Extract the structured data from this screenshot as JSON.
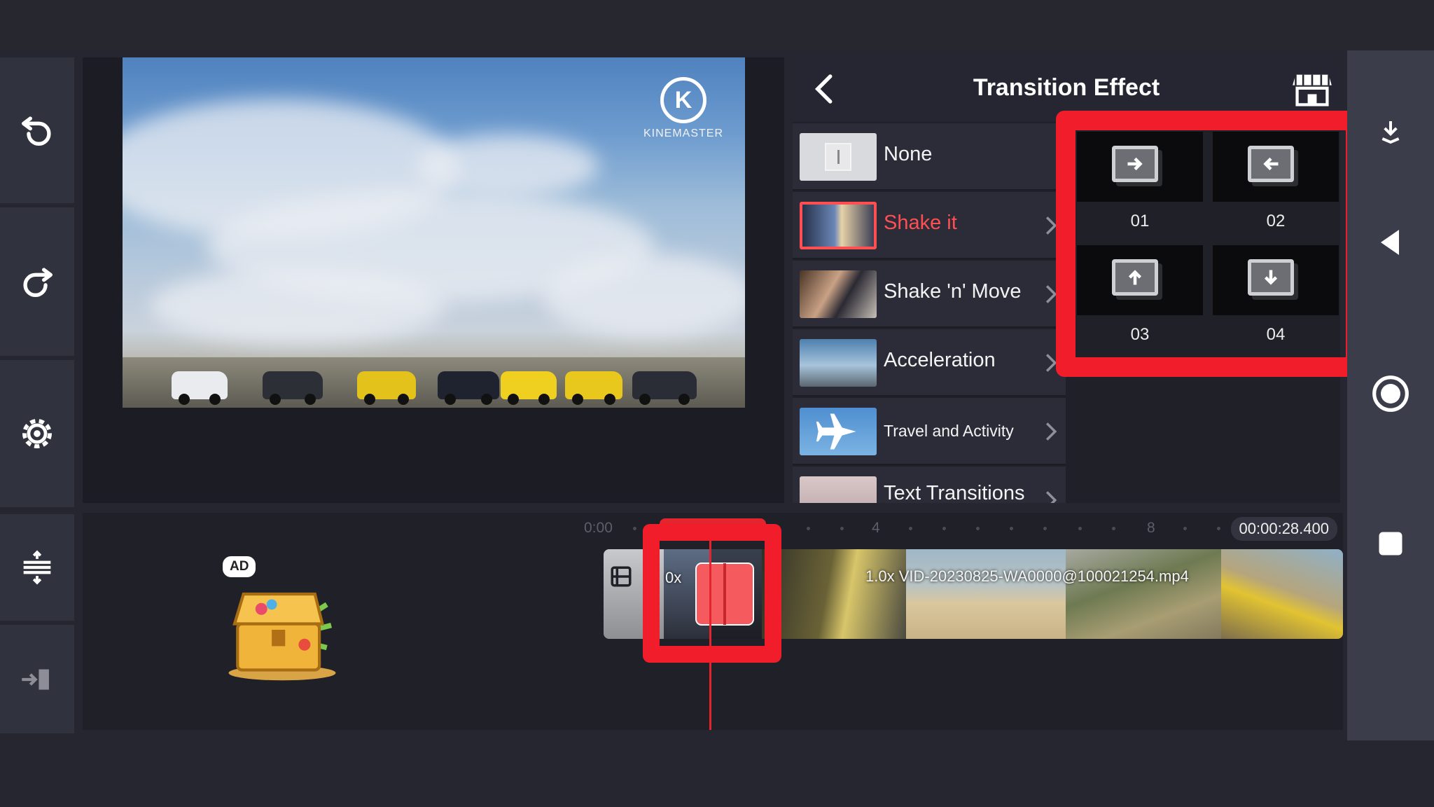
{
  "app": {
    "brand": "KINEMASTER",
    "brand_letter": "K"
  },
  "panel": {
    "title": "Transition Effect",
    "items": [
      {
        "label": "None",
        "selected": false
      },
      {
        "label": "Shake it",
        "selected": true
      },
      {
        "label": "Shake 'n' Move",
        "selected": false
      },
      {
        "label": "Acceleration",
        "selected": false
      },
      {
        "label": "Travel and Activity",
        "selected": false
      },
      {
        "label": "Text Transitions",
        "selected": false
      }
    ],
    "options": [
      {
        "label": "01",
        "icon": "arrow-right-icon"
      },
      {
        "label": "02",
        "icon": "arrow-left-icon"
      },
      {
        "label": "03",
        "icon": "arrow-up-icon"
      },
      {
        "label": "04",
        "icon": "arrow-down-icon"
      }
    ]
  },
  "timeline": {
    "ruler_start": "0:00",
    "ruler_marks": [
      "4",
      "8"
    ],
    "timecode": "00:00:28.400",
    "clip_label": "1.0x VID-20230825-WA0000@100021254.mp4",
    "clip_speed_prefix": "0x",
    "ad_badge": "AD"
  },
  "colors": {
    "accent_red": "#f11d2a",
    "selected_text": "#ff4f52",
    "panel_bg": "#1f2028",
    "rail_bg": "#3b3d4a"
  }
}
